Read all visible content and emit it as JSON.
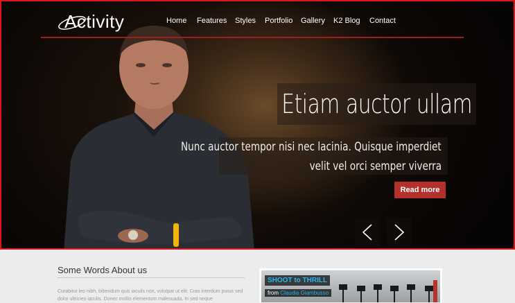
{
  "site": {
    "logo_text": "Activity"
  },
  "nav": {
    "items": [
      "Home",
      "Features",
      "Styles",
      "Portfolio",
      "Gallery",
      "K2 Blog",
      "Contact"
    ]
  },
  "slide": {
    "title": "Etiam auctor ullam",
    "subtitle_lines": [
      "Nunc auctor tempor nisi nec lacinia. Quisque imperdiet",
      "velit vel orci semper viverra"
    ],
    "read_more_label": "Read more",
    "prev_icon": "chevron-left-icon",
    "next_icon": "chevron-right-icon"
  },
  "about": {
    "title": "Some Words About us",
    "text": "Curabitur leo nibh, bibendum quis iaculis non, volutpat ut elit. Cras interdum purus sed dolor ultricies iaculis. Donec mollis elementum malesuada. In sed neque"
  },
  "thumbnail": {
    "title": "SHOOT to THRILL",
    "from_label": "from",
    "author": "Claudia Giambusso"
  },
  "colors": {
    "accent_red": "#b3302b",
    "frame_red": "#e0141b",
    "link_blue": "#2bb5ea"
  }
}
